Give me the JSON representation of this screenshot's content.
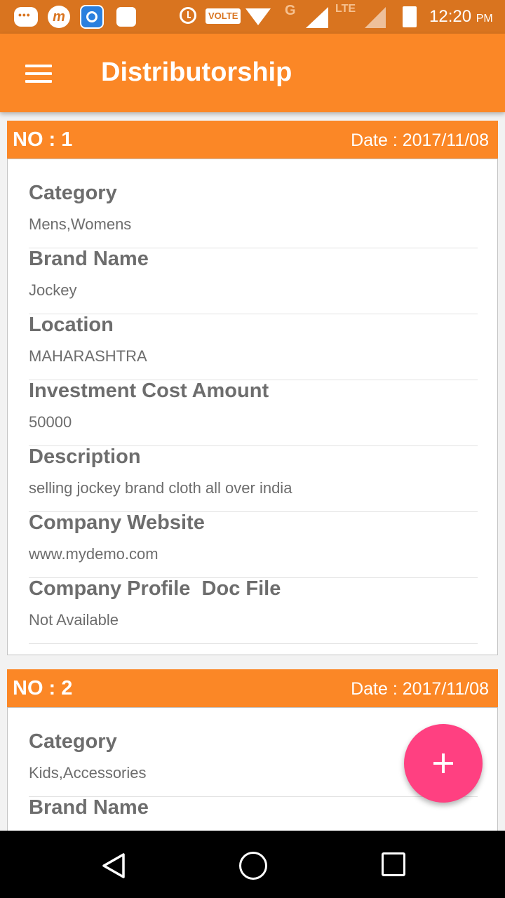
{
  "status_bar": {
    "time": "12:20",
    "ampm": "PM",
    "volte": "VOLTE",
    "network_g": "G",
    "network_lte": "LTE"
  },
  "app_bar": {
    "title": "Distributorship"
  },
  "cards": [
    {
      "no": "NO : 1",
      "date": "Date : 2017/11/08",
      "fields": [
        {
          "label": "Category",
          "value": "Mens,Womens"
        },
        {
          "label": "Brand Name",
          "value": "Jockey"
        },
        {
          "label": "Location",
          "value": "MAHARASHTRA"
        },
        {
          "label": "Investment Cost Amount",
          "value": "50000"
        },
        {
          "label": "Description",
          "value": "selling jockey brand cloth all over india"
        },
        {
          "label": "Company Website",
          "value": "www.mydemo.com"
        },
        {
          "label": "Company Profile  Doc File",
          "value": "Not Available"
        }
      ]
    },
    {
      "no": "NO : 2",
      "date": "Date : 2017/11/08",
      "fields": [
        {
          "label": "Category",
          "value": "Kids,Accessories"
        },
        {
          "label": "Brand Name",
          "value": ""
        }
      ]
    }
  ],
  "fab": {
    "icon": "plus-icon"
  },
  "colors": {
    "accent": "#fb8726",
    "status_bar": "#d9741f",
    "fab": "#ff4081",
    "text": "#6d6d6d"
  }
}
